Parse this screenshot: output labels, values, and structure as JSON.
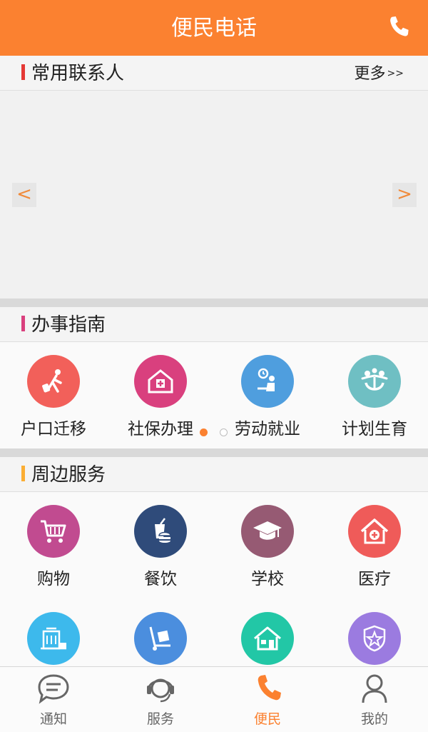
{
  "header": {
    "title": "便民电话",
    "icon": "phone-icon"
  },
  "contacts": {
    "title": "常用联系人",
    "more_label": "更多",
    "more_arrows": ">>",
    "prev": "<",
    "next": ">"
  },
  "guide": {
    "title": "办事指南",
    "items": [
      {
        "label": "户口迁移",
        "icon": "walking-person-luggage-icon",
        "color": "#f2605a"
      },
      {
        "label": "社保办理",
        "icon": "insurance-house-icon",
        "color": "#d9407e"
      },
      {
        "label": "劳动就业",
        "icon": "office-worker-icon",
        "color": "#4f9ede"
      },
      {
        "label": "计划生育",
        "icon": "family-icon",
        "color": "#6fbfc3"
      }
    ],
    "page_dots": {
      "active": 1,
      "total": 2
    }
  },
  "nearby": {
    "title": "周边服务",
    "items": [
      {
        "label": "购物",
        "icon": "shopping-cart-icon",
        "color": "#c14b90"
      },
      {
        "label": "餐饮",
        "icon": "food-drink-icon",
        "color": "#2f4b7a"
      },
      {
        "label": "学校",
        "icon": "graduation-cap-icon",
        "color": "#965a73"
      },
      {
        "label": "医疗",
        "icon": "hospital-icon",
        "color": "#ef5b59"
      },
      {
        "label": "",
        "icon": "hotel-icon",
        "color": "#3db9ec"
      },
      {
        "label": "",
        "icon": "moving-dolly-icon",
        "color": "#4b8ede"
      },
      {
        "label": "",
        "icon": "house-icon",
        "color": "#22c7a6"
      },
      {
        "label": "",
        "icon": "shield-star-icon",
        "color": "#9b7be0"
      }
    ]
  },
  "bottom_nav": [
    {
      "label": "通知",
      "icon": "chat-bubble-icon",
      "active": false
    },
    {
      "label": "服务",
      "icon": "headset-icon",
      "active": false
    },
    {
      "label": "便民",
      "icon": "phone-icon",
      "active": true
    },
    {
      "label": "我的",
      "icon": "user-icon",
      "active": false
    }
  ],
  "colors": {
    "accent": "#fb8130",
    "bar_contacts": "#e53935",
    "bar_guide": "#d9407e",
    "bar_nearby": "#fbae34",
    "nav_inactive": "#666666"
  }
}
